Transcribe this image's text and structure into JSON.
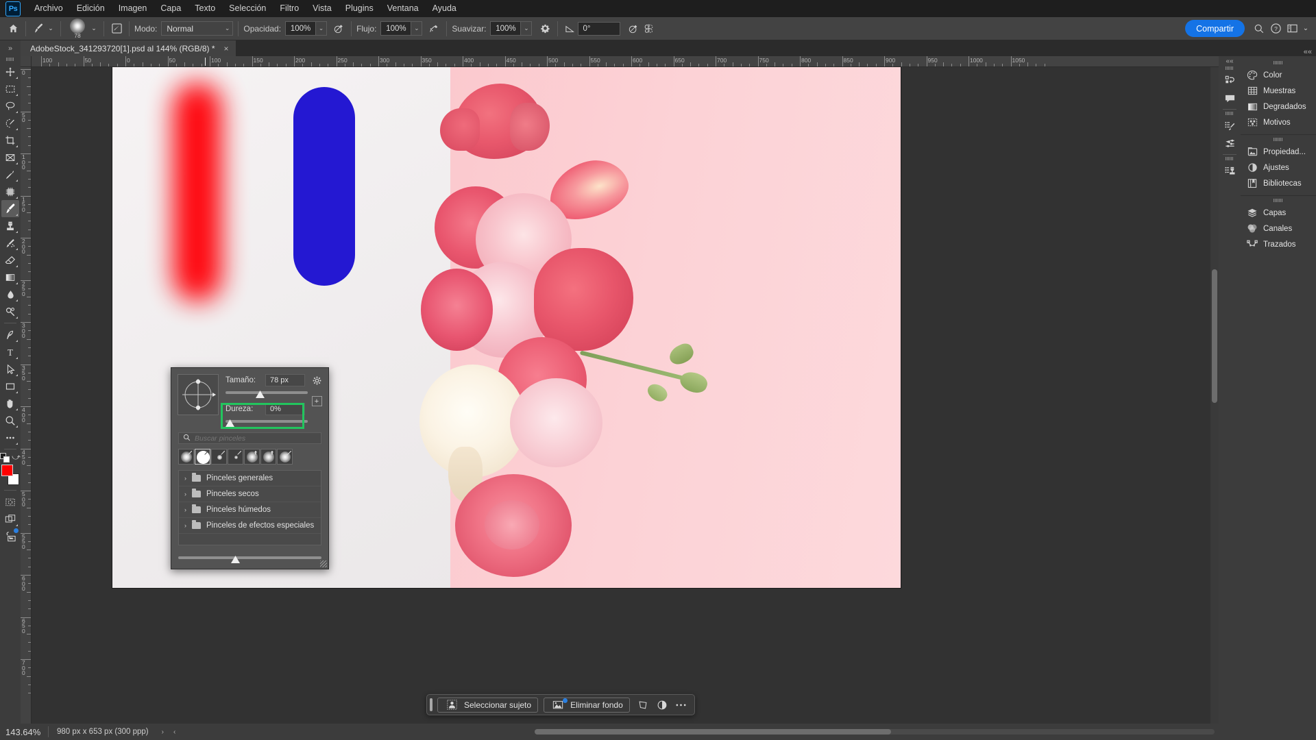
{
  "app": {
    "logo": "Ps",
    "name": "Adobe Photoshop"
  },
  "menubar": {
    "items": [
      "Archivo",
      "Edición",
      "Imagen",
      "Capa",
      "Texto",
      "Selección",
      "Filtro",
      "Vista",
      "Plugins",
      "Ventana",
      "Ayuda"
    ]
  },
  "options_bar": {
    "home_icon": "home-icon",
    "tool_icon": "brush-tool-icon",
    "brush_size_number": "78",
    "brush_settings_icon": "brush-settings-icon",
    "mode_label": "Modo:",
    "mode_value": "Normal",
    "opacity_label": "Opacidad:",
    "opacity_value": "100%",
    "pressure_opacity_icon": "pressure-opacity-icon",
    "flow_label": "Flujo:",
    "flow_value": "100%",
    "airbrush_icon": "airbrush-icon",
    "smoothing_label": "Suavizar:",
    "smoothing_value": "100%",
    "smoothing_gear_icon": "gear-icon",
    "angle_icon": "angle-icon",
    "angle_value": "0°",
    "pressure_size_icon": "pressure-size-icon",
    "symmetry_icon": "symmetry-butterfly-icon",
    "share_label": "Compartir",
    "search_icon": "search-icon",
    "help_icon": "help-icon",
    "workspace_icon": "workspace-icon",
    "chevron_icon": "chevron-down-icon"
  },
  "tabbar": {
    "expand_label": "»",
    "collapse_label": "««",
    "document_title": "AdobeStock_341293720[1].psd al 144% (RGB/8) *",
    "close_label": "×"
  },
  "toolbar": {
    "tools": [
      {
        "name": "move-tool",
        "icon": "move-icon",
        "selected": false
      },
      {
        "name": "marquee-tool",
        "icon": "rect-marquee-icon",
        "selected": false
      },
      {
        "name": "lasso-tool",
        "icon": "lasso-icon",
        "selected": false
      },
      {
        "name": "object-selection-tool",
        "icon": "object-selection-icon",
        "selected": false
      },
      {
        "name": "crop-tool",
        "icon": "crop-icon",
        "selected": false
      },
      {
        "name": "frame-tool",
        "icon": "frame-icon",
        "selected": false
      },
      {
        "name": "eyedropper-tool",
        "icon": "eyedropper-icon",
        "selected": false
      },
      {
        "name": "spot-healing-tool",
        "icon": "spot-healing-icon",
        "selected": false
      },
      {
        "name": "brush-tool",
        "icon": "brush-icon",
        "selected": true
      },
      {
        "name": "clone-stamp-tool",
        "icon": "clone-stamp-icon",
        "selected": false
      },
      {
        "name": "history-brush-tool",
        "icon": "history-brush-icon",
        "selected": false
      },
      {
        "name": "eraser-tool",
        "icon": "eraser-icon",
        "selected": false
      },
      {
        "name": "gradient-tool",
        "icon": "gradient-icon",
        "selected": false
      },
      {
        "name": "blur-tool",
        "icon": "blur-drop-icon",
        "selected": false
      },
      {
        "name": "dodge-tool",
        "icon": "dodge-icon",
        "selected": false
      },
      {
        "name": "pen-tool",
        "icon": "pen-icon",
        "selected": false
      },
      {
        "name": "type-tool",
        "icon": "type-icon",
        "selected": false
      },
      {
        "name": "path-selection-tool",
        "icon": "path-arrow-icon",
        "selected": false
      },
      {
        "name": "shape-tool",
        "icon": "rectangle-shape-icon",
        "selected": false
      },
      {
        "name": "hand-tool",
        "icon": "hand-icon",
        "selected": false
      },
      {
        "name": "zoom-tool",
        "icon": "magnifier-icon",
        "selected": false
      },
      {
        "name": "edit-toolbar",
        "icon": "ellipsis-icon",
        "selected": false
      }
    ],
    "foreground_color": "#ff0000",
    "background_color": "#ffffff",
    "swap_icon": "swap-colors-icon",
    "default_colors_icon": "default-colors-icon",
    "quick_mask_icon": "quick-mask-icon",
    "screen_mode_icon": "screen-mode-icon",
    "share_image_icon": "share-image-icon"
  },
  "rulers": {
    "h_labels": [
      "100",
      "50",
      "0",
      "50",
      "100",
      "150",
      "200",
      "250",
      "300",
      "350",
      "400",
      "450",
      "500",
      "550",
      "600",
      "650",
      "700",
      "750",
      "800",
      "850",
      "900",
      "950",
      "1000",
      "1050"
    ],
    "v_labels": [
      "0",
      "50",
      "100",
      "150",
      "200",
      "250",
      "300",
      "350",
      "400",
      "450",
      "500",
      "550",
      "600",
      "650",
      "700"
    ],
    "unit": "px"
  },
  "brush_panel": {
    "size_label": "Tamaño:",
    "size_value": "78 px",
    "hardness_label": "Dureza:",
    "hardness_value": "0%",
    "gear_icon": "gear-icon",
    "new_preset_icon": "new-preset-icon",
    "search_icon": "search-icon",
    "search_placeholder": "Buscar pinceles",
    "highlight_color": "#22c55e",
    "preset_thumbs": [
      {
        "name": "soft-round-brush",
        "hard": false,
        "glyph": "brush"
      },
      {
        "name": "soft-round-brush-selected",
        "hard": true,
        "glyph": "brush",
        "selected": true
      },
      {
        "name": "hard-round-brush-small",
        "hard": false,
        "glyph": "brush"
      },
      {
        "name": "hard-round-brush-tiny",
        "hard": false,
        "glyph": "brush"
      },
      {
        "name": "soft-round-pressure-size",
        "hard": false,
        "glyph": "pressure"
      },
      {
        "name": "soft-round-pressure-opacity",
        "hard": false,
        "glyph": "pressure"
      },
      {
        "name": "soft-round-blend",
        "hard": false,
        "glyph": "blend"
      }
    ],
    "folders": [
      {
        "label": "Pinceles generales"
      },
      {
        "label": "Pinceles secos"
      },
      {
        "label": "Pinceles húmedos"
      },
      {
        "label": "Pinceles de efectos especiales"
      }
    ]
  },
  "context_toolbar": {
    "select_subject_label": "Seleccionar sujeto",
    "select_subject_icon": "select-subject-icon",
    "remove_bg_label": "Eliminar fondo",
    "remove_bg_icon": "remove-background-icon",
    "transform_icon": "transform-icon",
    "adjustment_icon": "adjustment-circle-icon",
    "more_icon": "ellipsis-icon"
  },
  "right_strip": {
    "collapse_label": "««",
    "icons": [
      {
        "name": "history-icon"
      },
      {
        "name": "comments-icon"
      },
      {
        "name": "brush-settings-panel-icon"
      },
      {
        "name": "brushes-panel-icon"
      },
      {
        "name": "clone-source-icon"
      }
    ]
  },
  "right_panel": {
    "groups": [
      {
        "items": [
          {
            "label": "Color",
            "icon": "color-palette-icon"
          },
          {
            "label": "Muestras",
            "icon": "swatches-grid-icon"
          },
          {
            "label": "Degradados",
            "icon": "gradient-icon"
          },
          {
            "label": "Motivos",
            "icon": "patterns-icon"
          }
        ]
      },
      {
        "items": [
          {
            "label": "Propiedad...",
            "icon": "properties-icon"
          },
          {
            "label": "Ajustes",
            "icon": "adjustments-icon"
          },
          {
            "label": "Bibliotecas",
            "icon": "libraries-icon"
          }
        ]
      },
      {
        "items": [
          {
            "label": "Capas",
            "icon": "layers-icon"
          },
          {
            "label": "Canales",
            "icon": "channels-icon"
          },
          {
            "label": "Trazados",
            "icon": "paths-icon"
          }
        ]
      }
    ]
  },
  "statusbar": {
    "zoom_value": "143.64%",
    "doc_dimensions": "980 px x 653 px (300 ppp)",
    "next_arrow": "›",
    "prev_arrow": "‹"
  },
  "canvas": {
    "artboard_bg_left": "#f2eff0",
    "artboard_bg_right": "#fbc9ce",
    "red_stroke_color": "#ff0008",
    "blue_stroke_color": "#2418d2"
  }
}
